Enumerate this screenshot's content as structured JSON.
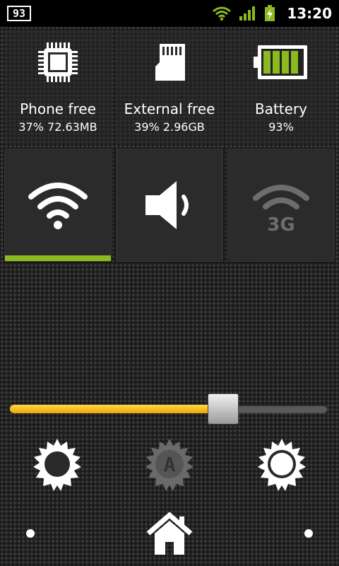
{
  "status_bar": {
    "notification_count": "93",
    "time": "13:20",
    "icons": [
      "notification-count-icon",
      "wifi-signal-icon",
      "cell-signal-icon",
      "battery-charging-icon"
    ]
  },
  "stats": [
    {
      "icon": "chip-icon",
      "title": "Phone free",
      "value": "37%  72.63MB"
    },
    {
      "icon": "sd-card-icon",
      "title": "External free",
      "value": "39%  2.96GB"
    },
    {
      "icon": "battery-icon",
      "title": "Battery",
      "value": "93%"
    }
  ],
  "toggles": [
    {
      "icon": "wifi-icon",
      "state": "on"
    },
    {
      "icon": "volume-icon",
      "state": "off"
    },
    {
      "icon": "3g-icon",
      "state": "disabled"
    }
  ],
  "brightness": {
    "level": 0.67,
    "buttons": [
      "brightness-low-icon",
      "brightness-auto-icon",
      "brightness-high-icon"
    ]
  },
  "colors": {
    "accent_green": "#8ab920",
    "slider_fill": "#f5b400",
    "status_bg": "#000000"
  },
  "nav": {
    "home_icon": "home-icon"
  }
}
